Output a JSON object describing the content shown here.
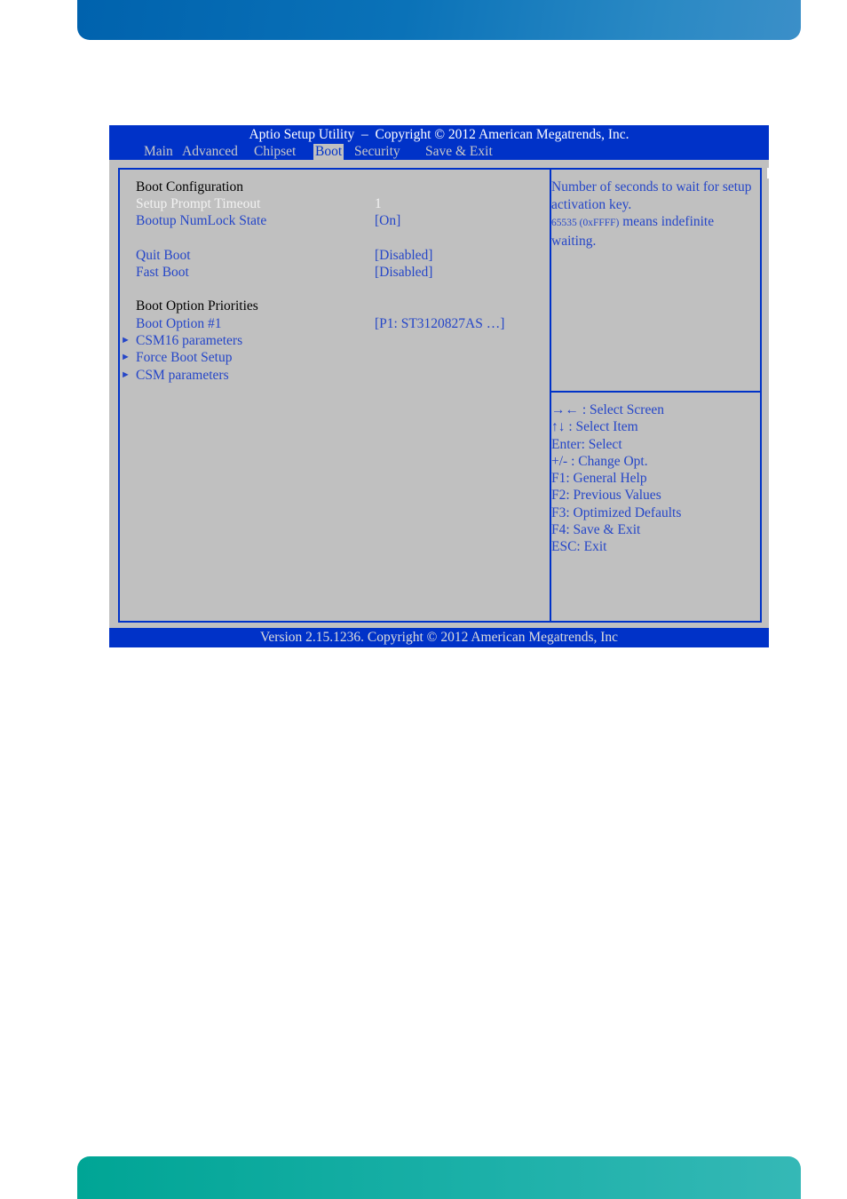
{
  "header": {
    "title": "Aptio Setup Utility  –  Copyright © 2012 American Megatrends, Inc.",
    "tabs": [
      {
        "label": "Main",
        "active": false
      },
      {
        "label": "Advanced",
        "active": false
      },
      {
        "label": "Chipset",
        "active": false
      },
      {
        "label": "Boot",
        "active": true
      },
      {
        "label": "Security",
        "active": false
      },
      {
        "label": "Save & Exit",
        "active": false
      }
    ]
  },
  "main": {
    "section_boot_config": "Boot Configuration",
    "items": {
      "setup_prompt_timeout": {
        "label": "Setup Prompt Timeout",
        "value": "1",
        "selected": true
      },
      "bootup_numlock": {
        "label": "Bootup NumLock State",
        "value": "[On]"
      },
      "quiet_boot": {
        "label": "Quit Boot",
        "value": "[Disabled]"
      },
      "fast_boot": {
        "label": "Fast Boot",
        "value": "[Disabled]"
      }
    },
    "section_boot_priorities": "Boot Option Priorities",
    "boot_option_1": {
      "label": "Boot Option #1",
      "value": "[P1: ST3120827AS  …]"
    },
    "submenus": [
      {
        "label": "CSM16 parameters",
        "icon": "submenu-arrow-icon",
        "glyph": "►"
      },
      {
        "label": "Force Boot Setup",
        "icon": "submenu-arrow-icon",
        "glyph": "►"
      },
      {
        "label": "CSM parameters",
        "icon": "submenu-arrow-icon",
        "glyph": "►"
      }
    ]
  },
  "help": {
    "line1": "Number of seconds to wait for setup activation key.",
    "line2_small": "65535 (0xFFFF)",
    "line2_rest": " means indefinite waiting."
  },
  "keys": [
    "→← : Select Screen",
    "↑↓ : Select Item",
    "Enter: Select",
    "+/- : Change Opt.",
    "F1: General Help",
    "F2: Previous Values",
    "F3: Optimized Defaults",
    "F4: Save & Exit",
    "ESC: Exit"
  ],
  "footer": {
    "version": "Version 2.15.1236. Copyright © 2012 American Megatrends, Inc"
  },
  "colors": {
    "bios_blue": "#0032c8",
    "bios_gray": "#c0c0c0",
    "text_blue": "#2546c8",
    "top_band": "#0a72b8",
    "bottom_band": "#1bb0a8"
  }
}
